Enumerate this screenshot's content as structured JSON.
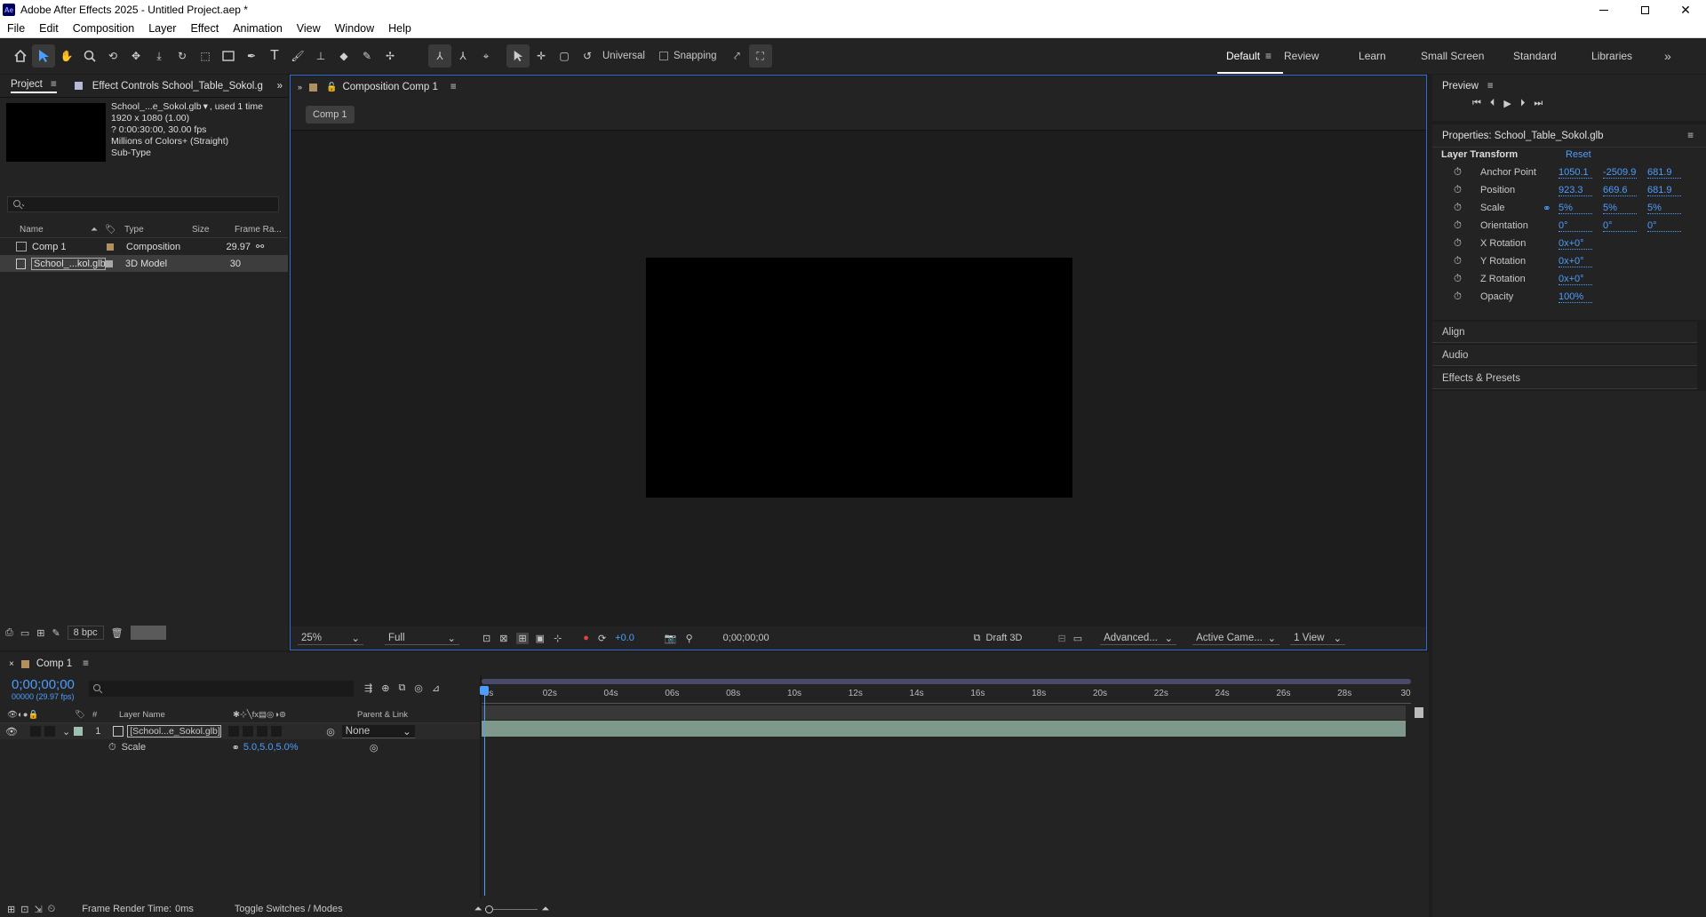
{
  "app": {
    "title": "Adobe After Effects 2025 - Untitled Project.aep *",
    "logo": "Ae"
  },
  "menu": [
    "File",
    "Edit",
    "Composition",
    "Layer",
    "Effect",
    "Animation",
    "View",
    "Window",
    "Help"
  ],
  "toolbar": {
    "universal": "Universal",
    "snapping": "Snapping"
  },
  "workspaces": [
    "Default",
    "Review",
    "Learn",
    "Small Screen",
    "Standard",
    "Libraries"
  ],
  "project": {
    "tab": "Project",
    "effect_tab": "Effect Controls School_Table_Sokol.g",
    "info": {
      "name": "School_...e_Sokol.glb",
      "used": ", used 1 time",
      "res": "1920 x 1080 (1.00)",
      "dur": "? 0:00:30:00, 30.00 fps",
      "colors": "Millions of Colors+ (Straight)",
      "subtype": "Sub-Type"
    },
    "columns": {
      "name": "Name",
      "type": "Type",
      "size": "Size",
      "fr": "Frame Ra..."
    },
    "items": [
      {
        "name": "Comp 1",
        "type": "Composition",
        "fr": "29.97",
        "color": "#b09060"
      },
      {
        "name": "School_...kol.glb",
        "type": "3D Model",
        "fr": "30",
        "color": "#a8a8a8"
      }
    ],
    "bpc": "8 bpc"
  },
  "comp": {
    "tab": "Composition Comp 1",
    "chip": "Comp 1",
    "zoom": "25%",
    "res": "Full",
    "exposure": "+0.0",
    "time": "0;00;00;00",
    "draft": "Draft 3D",
    "renderer": "Advanced...",
    "camera": "Active Came...",
    "view": "1 View"
  },
  "preview": {
    "title": "Preview"
  },
  "properties": {
    "title": "Properties: School_Table_Sokol.glb",
    "section": "Layer Transform",
    "reset": "Reset",
    "rows": [
      {
        "label": "Anchor Point",
        "v": [
          "1050.1",
          "-2509.9",
          "681.9"
        ]
      },
      {
        "label": "Position",
        "v": [
          "923.3",
          "669.6",
          "681.9"
        ]
      },
      {
        "label": "Scale",
        "v": [
          "5%",
          "5%",
          "5%"
        ],
        "link": true
      },
      {
        "label": "Orientation",
        "v": [
          "0°",
          "0°",
          "0°"
        ]
      },
      {
        "label": "X Rotation",
        "v": [
          "0x+0°"
        ]
      },
      {
        "label": "Y Rotation",
        "v": [
          "0x+0°"
        ]
      },
      {
        "label": "Z Rotation",
        "v": [
          "0x+0°"
        ]
      },
      {
        "label": "Opacity",
        "v": [
          "100%"
        ]
      }
    ],
    "panels": [
      "Align",
      "Audio",
      "Effects & Presets"
    ]
  },
  "timeline": {
    "tab": "Comp 1",
    "timecode": "0;00;00;00",
    "frames": "00000 (29.97 fps)",
    "cols": {
      "num": "#",
      "layer": "Layer Name",
      "parent": "Parent & Link"
    },
    "layer": {
      "num": "1",
      "name": "[School...e_Sokol.glb]",
      "parent": "None"
    },
    "prop": {
      "label": "Scale",
      "value": "5.0,5.0,5.0%"
    },
    "ruler": [
      "0s",
      "02s",
      "04s",
      "06s",
      "08s",
      "10s",
      "12s",
      "14s",
      "16s",
      "18s",
      "20s",
      "22s",
      "24s",
      "26s",
      "28s",
      "30"
    ],
    "render_time": "Frame Render Time:",
    "render_ms": "0ms",
    "toggle": "Toggle Switches / Modes"
  },
  "colors": {
    "accent": "#4d9dff",
    "comp_bar": "#9ec0b0",
    "panel": "#232323"
  }
}
